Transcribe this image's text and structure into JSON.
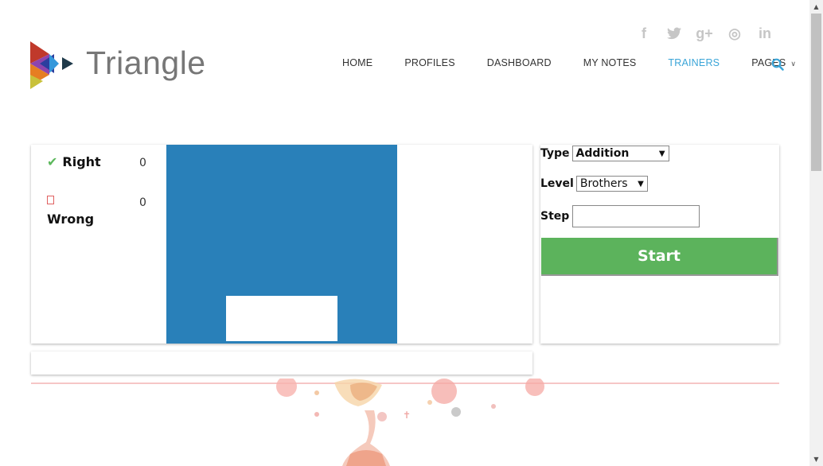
{
  "brand": {
    "name": "Triangle",
    "text_color": "#777777"
  },
  "social": [
    {
      "icon": "facebook-icon",
      "glyph": "f"
    },
    {
      "icon": "twitter-icon",
      "glyph": "t"
    },
    {
      "icon": "google-plus-icon",
      "glyph": "g+"
    },
    {
      "icon": "dribbble-icon",
      "glyph": "◎"
    },
    {
      "icon": "linkedin-icon",
      "glyph": "in"
    }
  ],
  "nav": {
    "items": [
      "HOME",
      "PROFILES",
      "DASHBOARD",
      "MY NOTES",
      "TRAINERS",
      "PAGES"
    ],
    "active": "TRAINERS",
    "active_color": "#3aa5d8",
    "pages_dropdown_icon": "chevron-down-icon",
    "search_icon": "search-icon"
  },
  "scoreboard": {
    "right_label": "Right",
    "right_count": "0",
    "wrong_label": "Wrong",
    "wrong_count": "0",
    "right_icon": "check-icon",
    "wrong_icon": "image-placeholder-icon"
  },
  "board": {
    "color": "#2980b9"
  },
  "form": {
    "type_label": "Type",
    "type_value": "Addition",
    "level_label": "Level",
    "level_value": "Brothers",
    "step_label": "Step",
    "step_value": ""
  },
  "start_button": {
    "label": "Start",
    "color": "#5cb35c"
  }
}
